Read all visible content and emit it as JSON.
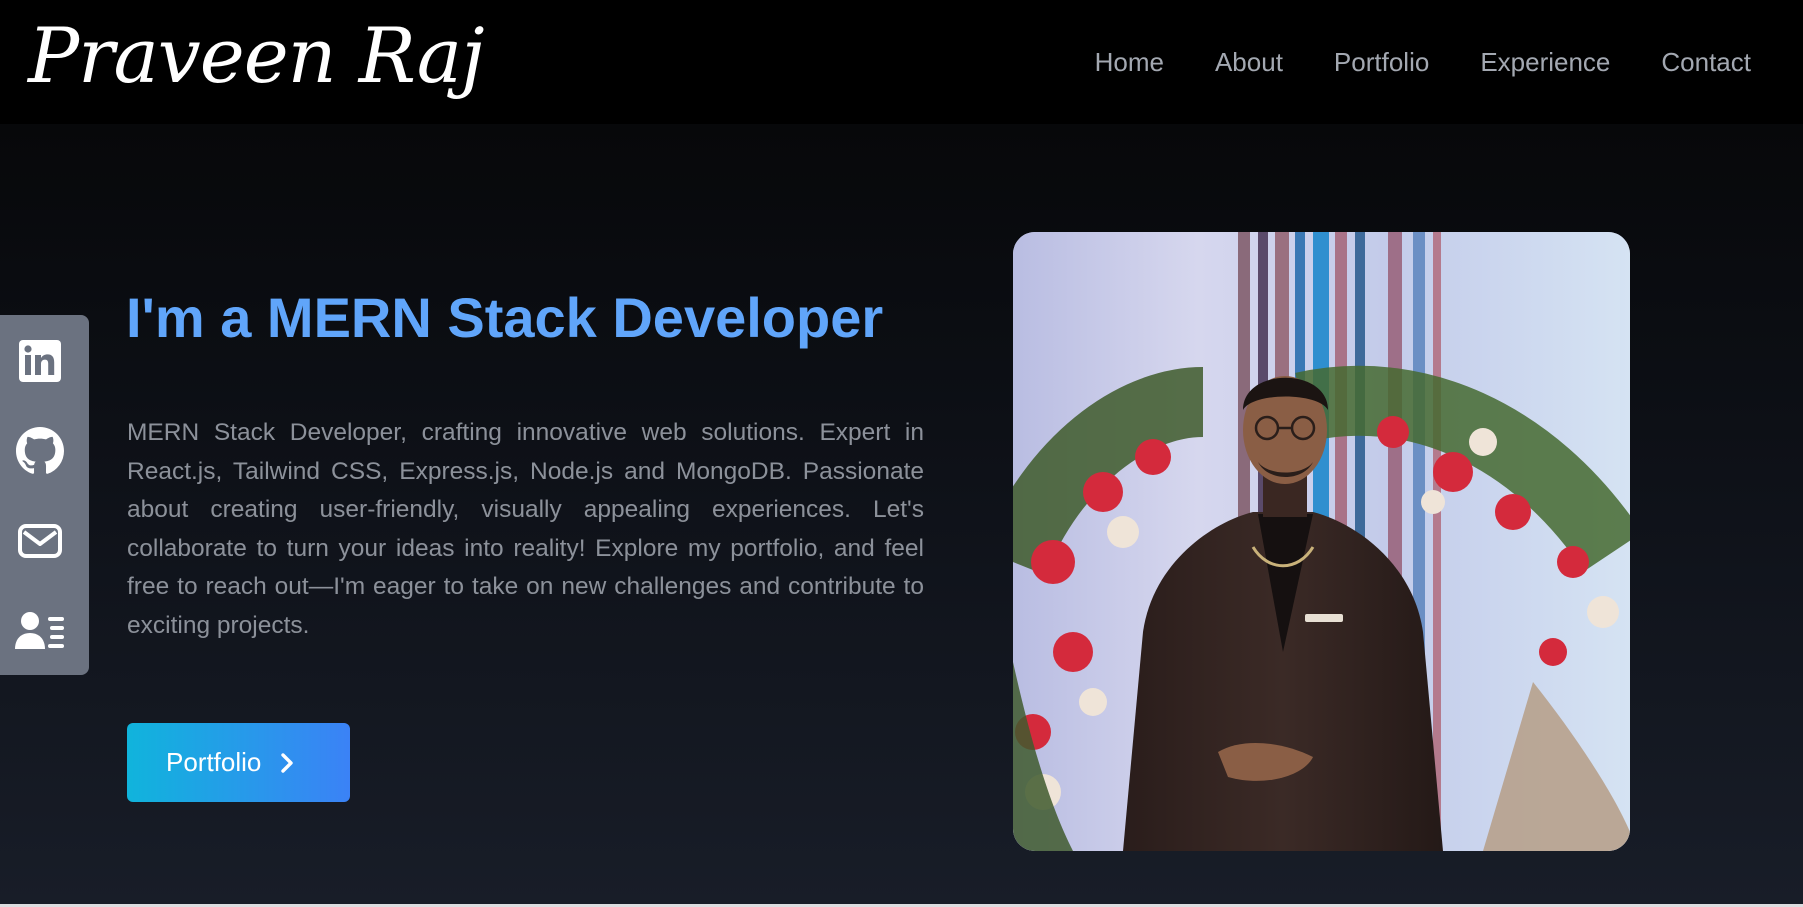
{
  "header": {
    "logo_text": "Praveen Raj",
    "nav": [
      {
        "label": "Home"
      },
      {
        "label": "About"
      },
      {
        "label": "Portfolio"
      },
      {
        "label": "Experience"
      },
      {
        "label": "Contact"
      }
    ]
  },
  "social": [
    {
      "icon": "linkedin-icon"
    },
    {
      "icon": "github-icon"
    },
    {
      "icon": "mail-icon"
    },
    {
      "icon": "resume-icon"
    }
  ],
  "hero": {
    "headline": "I'm a MERN Stack Developer",
    "intro": "MERN Stack Developer, crafting innovative web solutions. Expert in React.js, Tailwind CSS, Express.js, Node.js and MongoDB. Passionate about creating user-friendly, visually appealing experiences. Let's collaborate to turn your ideas into reality! Explore my portfolio, and feel free to reach out—I'm eager to take on new challenges and contribute to exciting projects.",
    "cta_label": "Portfolio",
    "cta_icon": "chevron-right-icon",
    "photo": "profile-photo"
  },
  "colors": {
    "accent": "#60a5fa",
    "button_from": "#10b4dc",
    "button_to": "#3b82f6",
    "sidebar": "#6b7280",
    "nav_text": "#a3a8b1",
    "body_text": "#8c919a"
  }
}
